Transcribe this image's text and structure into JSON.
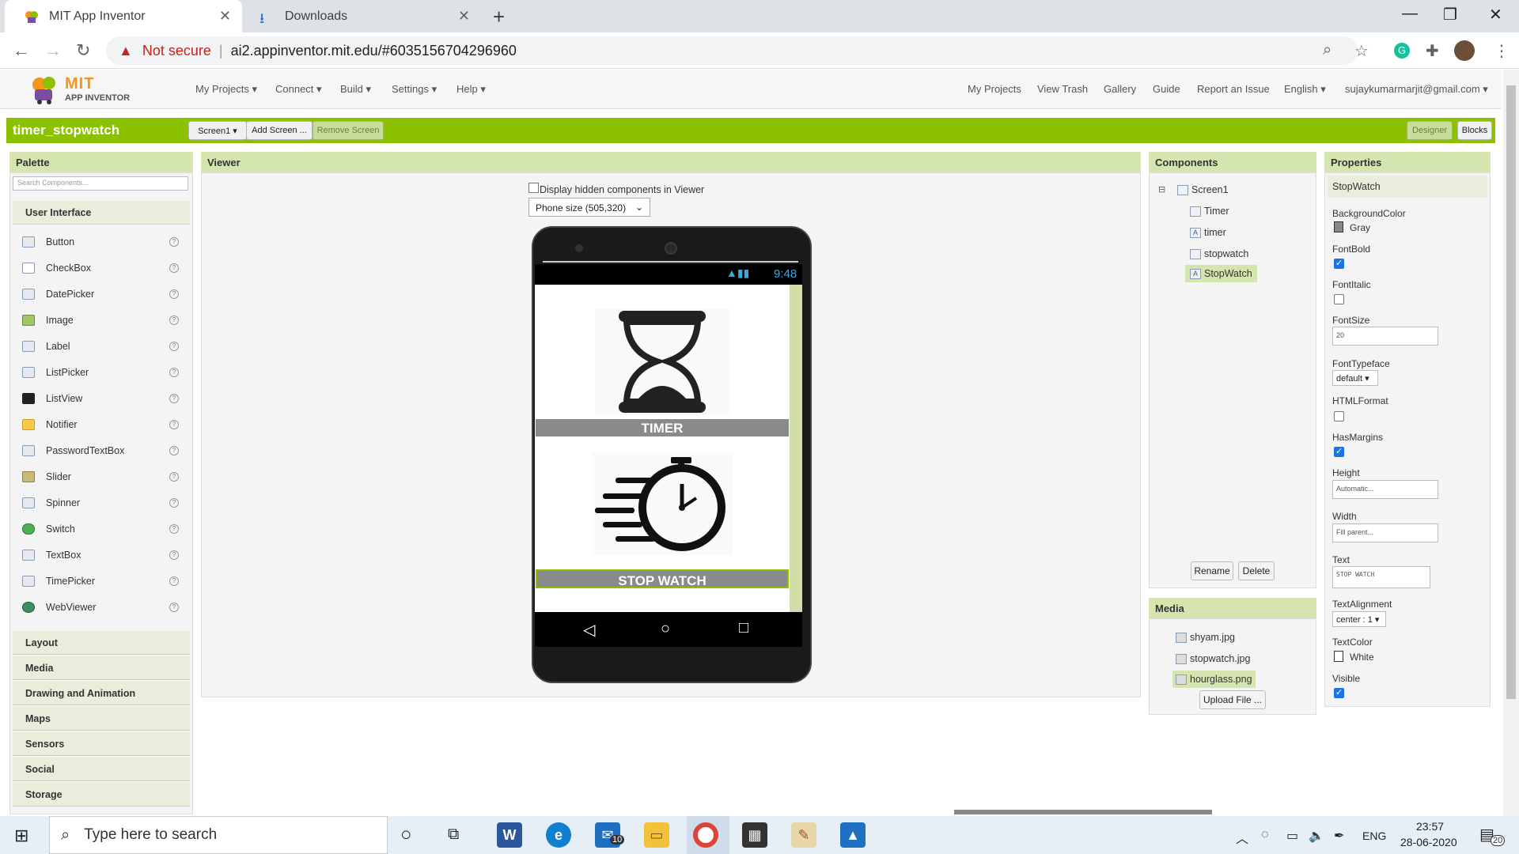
{
  "browser": {
    "tabs": [
      {
        "title": "MIT App Inventor",
        "active": true
      },
      {
        "title": "Downloads",
        "active": false
      }
    ],
    "security_label": "Not secure",
    "url": "ai2.appinventor.mit.edu/#6035156704296960"
  },
  "ai": {
    "logo_mit": "MIT",
    "logo_text": "APP INVENTOR",
    "menus": [
      "My Projects ▾",
      "Connect ▾",
      "Build ▾",
      "Settings ▾",
      "Help ▾"
    ],
    "right_links": [
      "My Projects",
      "View Trash",
      "Gallery",
      "Guide",
      "Report an Issue",
      "English ▾",
      "sujaykumarmarjit@gmail.com ▾"
    ]
  },
  "project": {
    "name": "timer_stopwatch",
    "screen_select": "Screen1 ▾",
    "add_screen": "Add Screen ...",
    "remove_screen": "Remove Screen",
    "designer": "Designer",
    "blocks": "Blocks"
  },
  "palette": {
    "title": "Palette",
    "search_placeholder": "Search Components...",
    "category_open": "User Interface",
    "items": [
      "Button",
      "CheckBox",
      "DatePicker",
      "Image",
      "Label",
      "ListPicker",
      "ListView",
      "Notifier",
      "PasswordTextBox",
      "Slider",
      "Spinner",
      "Switch",
      "TextBox",
      "TimePicker",
      "WebViewer"
    ],
    "help_glyph": "?",
    "categories": [
      "Layout",
      "Media",
      "Drawing and Animation",
      "Maps",
      "Sensors",
      "Social",
      "Storage"
    ]
  },
  "viewer": {
    "title": "Viewer",
    "hidden_label": "Display hidden components in Viewer",
    "phone_size": "Phone size (505,320)",
    "status_time": "9:48",
    "timer_label": "TIMER",
    "stopwatch_label": "STOP WATCH"
  },
  "components": {
    "title": "Components",
    "tree": [
      {
        "name": "Screen1",
        "icon": "screen-icon"
      },
      {
        "name": "Timer",
        "icon": "button-icon"
      },
      {
        "name": "timer",
        "icon": "label-icon"
      },
      {
        "name": "stopwatch",
        "icon": "button-icon"
      },
      {
        "name": "StopWatch",
        "icon": "label-icon",
        "selected": true
      }
    ],
    "rename": "Rename",
    "delete": "Delete"
  },
  "media": {
    "title": "Media",
    "files": [
      "shyam.jpg",
      "stopwatch.jpg",
      "hourglass.png"
    ],
    "upload": "Upload File ..."
  },
  "properties": {
    "title": "Properties",
    "component": "StopWatch",
    "background_color_label": "BackgroundColor",
    "background_color_value": "Gray",
    "font_bold_label": "FontBold",
    "font_bold": true,
    "font_italic_label": "FontItalic",
    "font_italic": false,
    "font_size_label": "FontSize",
    "font_size": "20",
    "font_typeface_label": "FontTypeface",
    "font_typeface": "default ▾",
    "html_format_label": "HTMLFormat",
    "html_format": false,
    "has_margins_label": "HasMargins",
    "has_margins": true,
    "height_label": "Height",
    "height": "Automatic...",
    "width_label": "Width",
    "width": "Fill parent...",
    "text_label": "Text",
    "text": "STOP WATCH",
    "text_alignment_label": "TextAlignment",
    "text_alignment": "center : 1 ▾",
    "text_color_label": "TextColor",
    "text_color_value": "White",
    "visible_label": "Visible",
    "visible": true
  },
  "taskbar": {
    "search_placeholder": "Type here to search",
    "mail_badge": "10",
    "lang": "ENG",
    "time": "23:57",
    "date": "28-06-2020",
    "notif_badge": "20"
  },
  "colors": {
    "ai_green": "#8cc100",
    "panel_header": "#d5e5b0",
    "phone_label_bar": "#8a8a8a"
  }
}
